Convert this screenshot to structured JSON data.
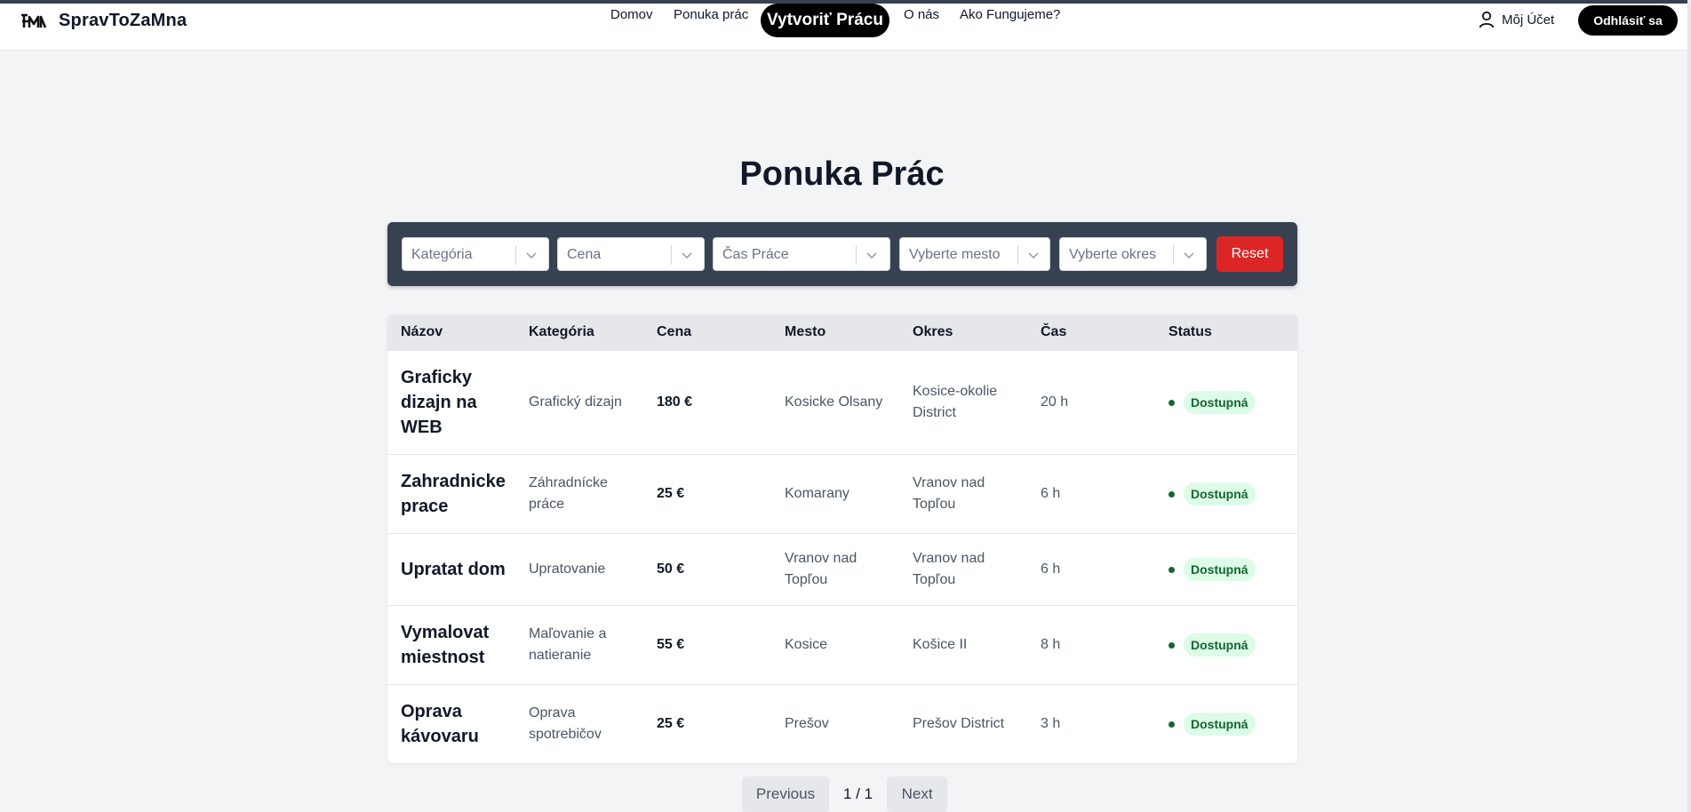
{
  "nav": {
    "brand": "SpravToZaMna",
    "links": [
      "Domov",
      "Ponuka prác",
      "O nás",
      "Ako Fungujeme?"
    ],
    "create_label": "Vytvoriť Prácu",
    "account_label": "Môj Účet",
    "logout_label": "Odhlásiť sa"
  },
  "page_title": "Ponuka Prác",
  "filters": {
    "category_placeholder": "Kategória",
    "price_placeholder": "Cena",
    "time_placeholder": "Čas Práce",
    "city_placeholder": "Vyberte mesto",
    "district_placeholder": "Vyberte okres",
    "reset_label": "Reset"
  },
  "table": {
    "headers": [
      "Názov",
      "Kategória",
      "Cena",
      "Mesto",
      "Okres",
      "Čas",
      "Status"
    ],
    "rows": [
      {
        "name": "Graficky dizajn na WEB",
        "category": "Grafický dizajn",
        "price": "180 €",
        "city": "Kosicke Olsany",
        "district": "Kosice-okolie District",
        "time": "20 h",
        "status": "Dostupná"
      },
      {
        "name": "Zahradnicke prace",
        "category": "Záhradnícke práce",
        "price": "25 €",
        "city": "Komarany",
        "district": "Vranov nad Topľou",
        "time": "6 h",
        "status": "Dostupná"
      },
      {
        "name": "Upratat dom",
        "category": "Upratovanie",
        "price": "50 €",
        "city": "Vranov nad Topľou",
        "district": "Vranov nad Topľou",
        "time": "6 h",
        "status": "Dostupná"
      },
      {
        "name": "Vymalovat miestnost",
        "category": "Maľovanie a natieranie",
        "price": "55 €",
        "city": "Kosice",
        "district": "Košice II",
        "time": "8 h",
        "status": "Dostupná"
      },
      {
        "name": "Oprava kávovaru",
        "category": "Oprava spotrebičov",
        "price": "25 €",
        "city": "Prešov",
        "district": "Prešov District",
        "time": "3 h",
        "status": "Dostupná"
      }
    ]
  },
  "pagination": {
    "previous_label": "Previous",
    "page_info": "1 / 1",
    "next_label": "Next"
  },
  "colors": {
    "reset": "#dc2626",
    "filter_bar": "#374151",
    "badge_bg": "#dcfce7",
    "badge_text": "#166534"
  }
}
